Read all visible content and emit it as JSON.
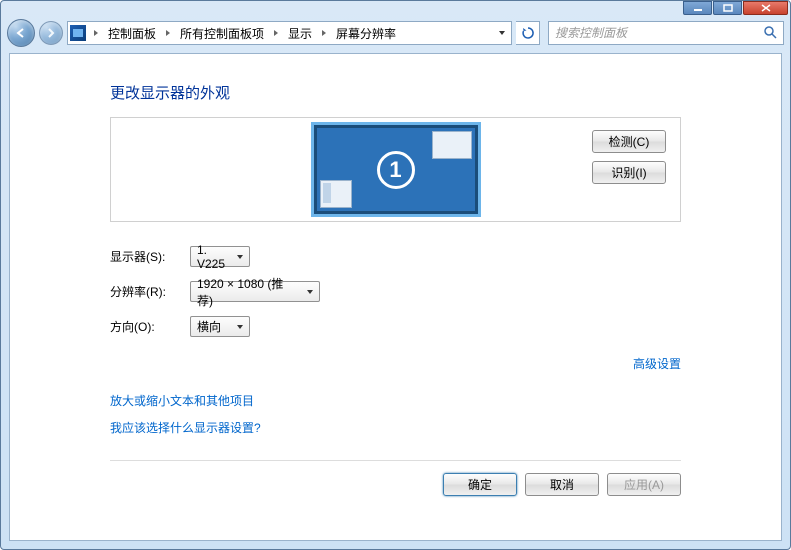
{
  "breadcrumbs": {
    "item0": "控制面板",
    "item1": "所有控制面板项",
    "item2": "显示",
    "item3": "屏幕分辨率"
  },
  "search": {
    "placeholder": "搜索控制面板"
  },
  "page": {
    "title": "更改显示器的外观"
  },
  "monitor": {
    "number": "1"
  },
  "buttons": {
    "detect": "检测(C)",
    "identify": "识别(I)",
    "ok": "确定",
    "cancel": "取消",
    "apply": "应用(A)"
  },
  "form": {
    "display_label": "显示器(S):",
    "display_value": "1. V225",
    "resolution_label": "分辨率(R):",
    "resolution_value": "1920 × 1080 (推荐)",
    "orientation_label": "方向(O):",
    "orientation_value": "横向"
  },
  "links": {
    "advanced": "高级设置",
    "zoom_text": "放大或缩小文本和其他项目",
    "which_settings": "我应该选择什么显示器设置?"
  }
}
